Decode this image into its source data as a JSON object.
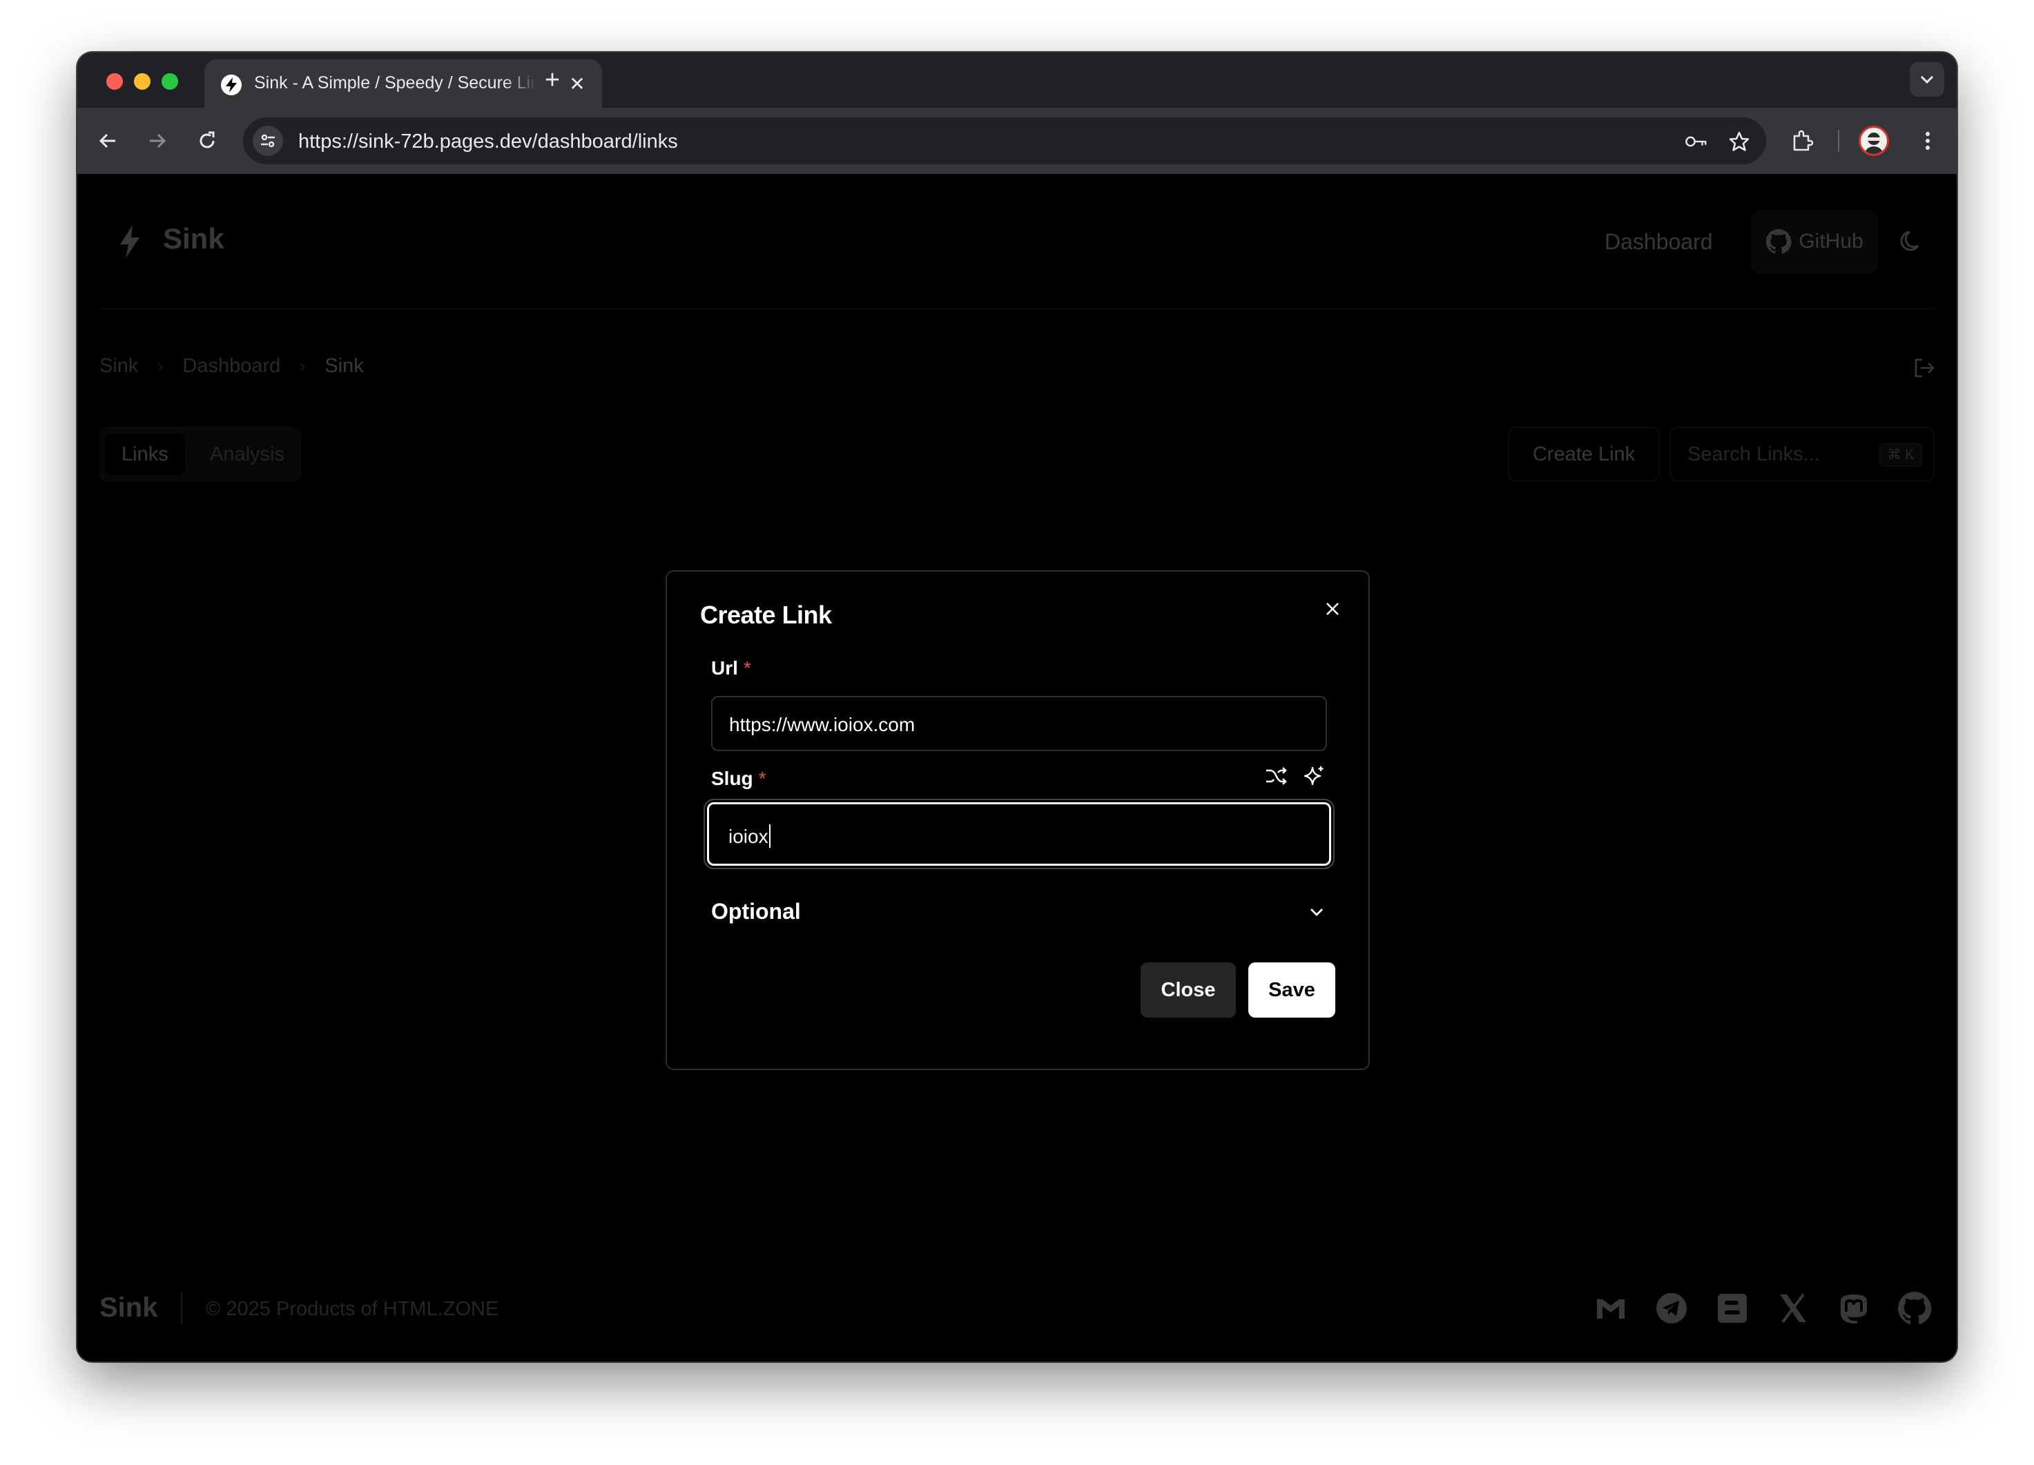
{
  "browser": {
    "tab_title": "Sink - A Simple / Speedy / Secure Link Shortener",
    "url": "https://sink-72b.pages.dev/dashboard/links"
  },
  "header": {
    "logo": "Sink",
    "nav_dashboard": "Dashboard",
    "github_label": "GitHub"
  },
  "breadcrumb": [
    "Sink",
    "Dashboard",
    "Sink"
  ],
  "tabs": {
    "links": "Links",
    "analysis": "Analysis"
  },
  "toolbar": {
    "create_link": "Create Link",
    "search_placeholder": "Search Links...",
    "search_shortcut": "⌘ K"
  },
  "footer": {
    "logo": "Sink",
    "copyright": "© 2025 Products of HTML.ZONE",
    "socials": [
      "gmail-icon",
      "telegram-icon",
      "blogger-icon",
      "x-icon",
      "mastodon-icon",
      "github-icon"
    ]
  },
  "modal": {
    "title": "Create Link",
    "url_label": "Url",
    "url_value": "https://www.ioiox.com",
    "slug_label": "Slug",
    "slug_value": "ioiox",
    "required_mark": "*",
    "optional_label": "Optional",
    "close_button": "Close",
    "save_button": "Save"
  },
  "colors": {
    "background": "#000000",
    "required": "#e5484d",
    "browser_chrome": "#35363a"
  }
}
